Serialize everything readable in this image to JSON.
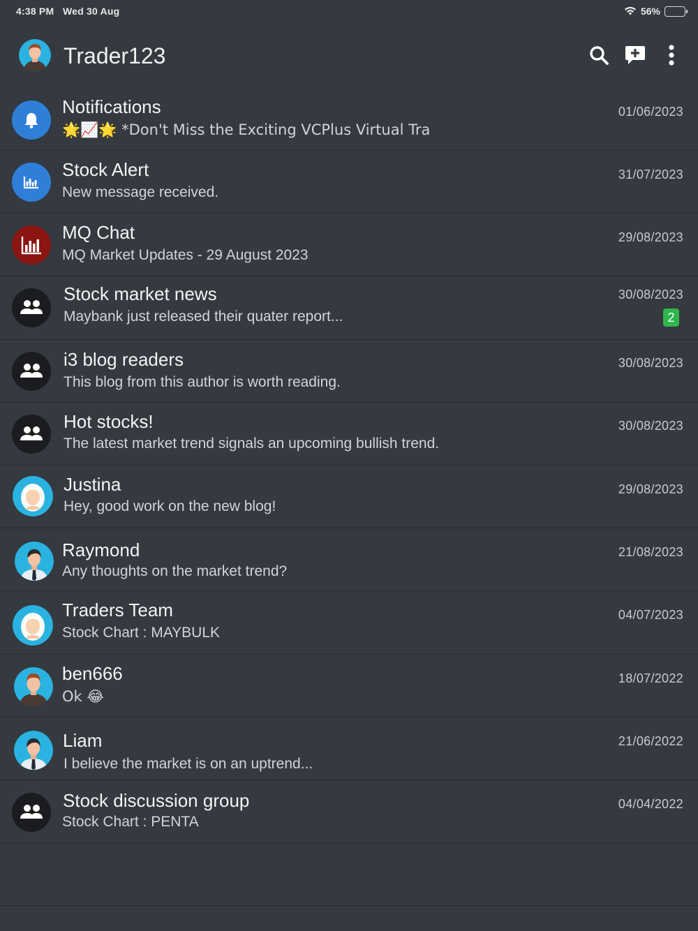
{
  "status_bar": {
    "time": "4:38 PM",
    "date": "Wed 30 Aug",
    "battery": "56%",
    "battery_level": 0.56,
    "icons": [
      "wifi-icon",
      "battery-icon"
    ]
  },
  "header": {
    "title": "Trader123",
    "actions": [
      "search-icon",
      "new-chat-icon",
      "more-vertical-icon"
    ]
  },
  "colors": {
    "background": "#353940",
    "divider": "#2a2d33",
    "badge": "#2fb54c",
    "blue_avatar": "#2f7fd8",
    "red_avatar": "#8a1511",
    "group_avatar": "#1b1c1f",
    "person_avatar": "#2ab3e0"
  },
  "chats": [
    {
      "name": "Notifications",
      "preview": "🌟📈🌟 *Don't Miss the Exciting VCPlus Virtual Tra",
      "date": "01/06/2023",
      "avatar": "bell-icon",
      "unread": ""
    },
    {
      "name": "Stock Alert",
      "preview": "New message received.",
      "date": "31/07/2023",
      "avatar": "chart-icon",
      "unread": ""
    },
    {
      "name": "MQ Chat",
      "preview": "MQ Market Updates - 29 August 2023",
      "date": "29/08/2023",
      "avatar": "bar-chart-icon",
      "unread": ""
    },
    {
      "name": "Stock market news",
      "preview": "Maybank just released their quater report...",
      "date": "30/08/2023",
      "avatar": "group-icon",
      "unread": "2"
    },
    {
      "name": "i3 blog readers",
      "preview": "This blog from this author is worth reading.",
      "date": "30/08/2023",
      "avatar": "group-icon",
      "unread": ""
    },
    {
      "name": "Hot stocks!",
      "preview": "The latest market trend signals an upcoming bullish trend.",
      "date": "30/08/2023",
      "avatar": "group-icon",
      "unread": ""
    },
    {
      "name": "Justina",
      "preview": "Hey, good work on the new blog!",
      "date": "29/08/2023",
      "avatar": "woman-avatar-icon",
      "unread": ""
    },
    {
      "name": "Raymond",
      "preview": "Any thoughts on the market trend?",
      "date": "21/08/2023",
      "avatar": "man-tie-avatar-icon",
      "unread": ""
    },
    {
      "name": "Traders Team",
      "preview": "Stock Chart : MAYBULK",
      "date": "04/07/2023",
      "avatar": "woman-avatar-icon",
      "unread": ""
    },
    {
      "name": "ben666",
      "preview": "Ok 😂",
      "date": "18/07/2022",
      "avatar": "man-avatar-icon",
      "unread": ""
    },
    {
      "name": "Liam",
      "preview": "I believe the market is on an uptrend...",
      "date": "21/06/2022",
      "avatar": "man-tie-avatar-icon",
      "unread": ""
    },
    {
      "name": "Stock discussion group",
      "preview": "Stock Chart : PENTA",
      "date": "04/04/2022",
      "avatar": "group-icon",
      "unread": ""
    }
  ]
}
